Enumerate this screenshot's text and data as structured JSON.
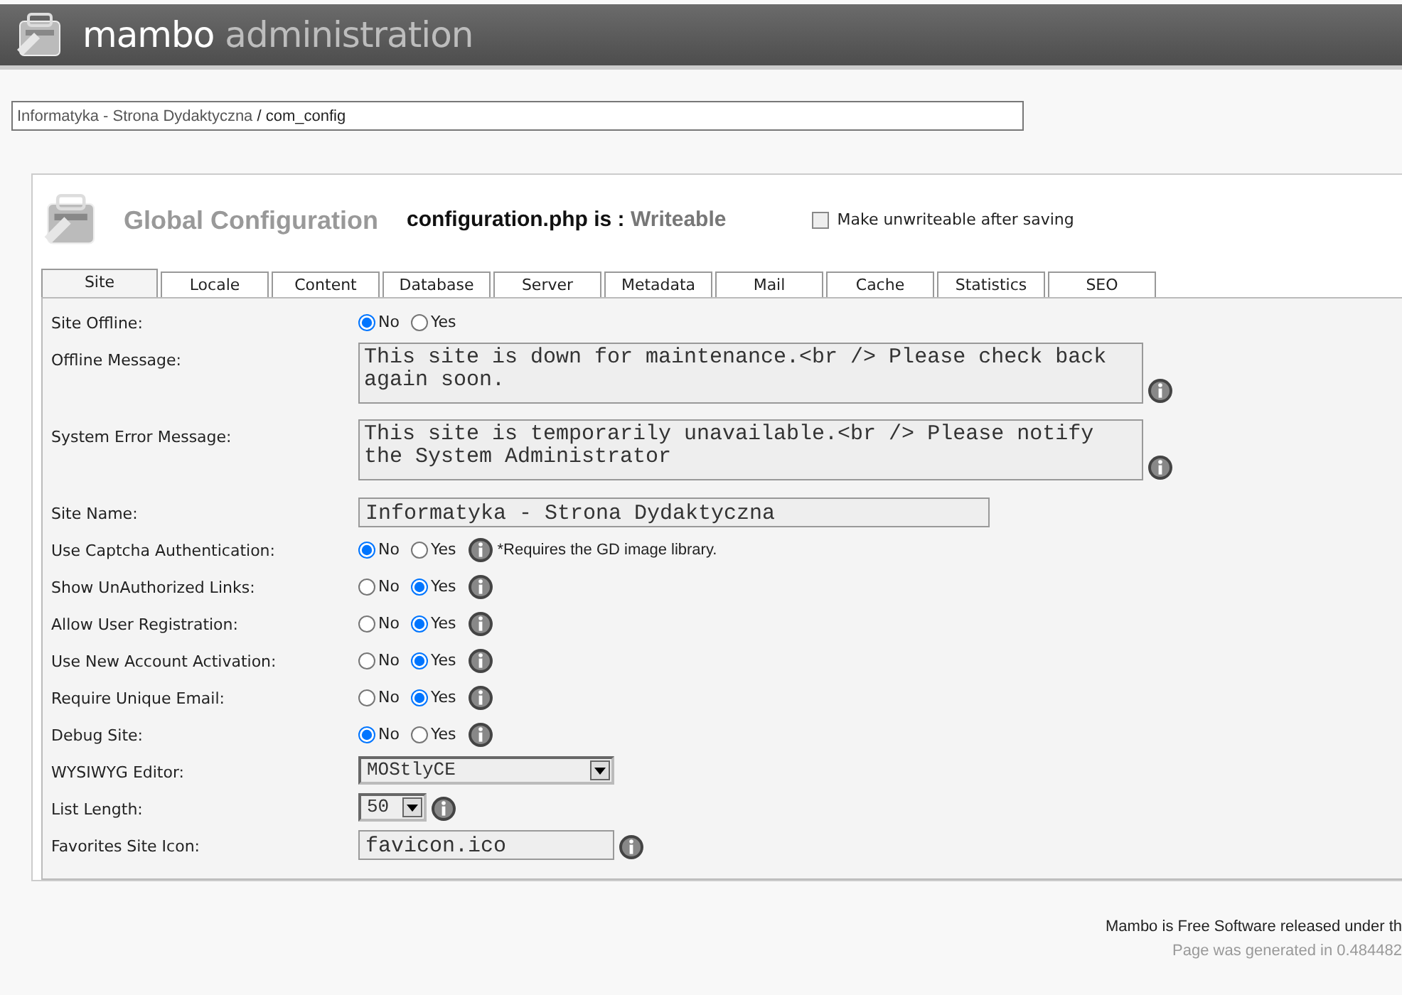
{
  "header": {
    "brand_bold": "mambo",
    "brand_light": "administration"
  },
  "pathway": {
    "site": "Informatyka - Strona Dydaktyczna",
    "rest": " / com_config"
  },
  "config": {
    "title": "Global Configuration",
    "file_label": "configuration.php is :",
    "file_status": "Writeable",
    "unwriteable": {
      "label": "Make unwriteable after saving",
      "checked": false
    }
  },
  "tabs": [
    {
      "label": "Site",
      "selected": true
    },
    {
      "label": "Locale",
      "selected": false
    },
    {
      "label": "Content",
      "selected": false
    },
    {
      "label": "Database",
      "selected": false
    },
    {
      "label": "Server",
      "selected": false
    },
    {
      "label": "Metadata",
      "selected": false
    },
    {
      "label": "Mail",
      "selected": false
    },
    {
      "label": "Cache",
      "selected": false
    },
    {
      "label": "Statistics",
      "selected": false
    },
    {
      "label": "SEO",
      "selected": false
    }
  ],
  "rows": [
    {
      "label": "Site Offline:",
      "kind": "radio",
      "info": false,
      "options": [
        {
          "label": "No",
          "selected": true
        },
        {
          "label": "Yes",
          "selected": false
        }
      ]
    },
    {
      "label": "Offline Message:",
      "kind": "textarea",
      "info": true,
      "value": "This site is down for maintenance.<br /> Please check back again soon."
    },
    {
      "label": "System Error Message:",
      "kind": "textarea",
      "info": true,
      "value": "This site is temporarily unavailable.<br /> Please notify the System Administrator"
    },
    {
      "label": "Site Name:",
      "kind": "text",
      "info": false,
      "value": "Informatyka - Strona Dydaktyczna"
    },
    {
      "label": "Use Captcha Authentication:",
      "kind": "radio",
      "info": true,
      "note": "*Requires the GD image library.",
      "options": [
        {
          "label": "No",
          "selected": true
        },
        {
          "label": "Yes",
          "selected": false
        }
      ]
    },
    {
      "label": "Show UnAuthorized Links:",
      "kind": "radio",
      "info": true,
      "options": [
        {
          "label": "No",
          "selected": false
        },
        {
          "label": "Yes",
          "selected": true
        }
      ]
    },
    {
      "label": "Allow User Registration:",
      "kind": "radio",
      "info": true,
      "options": [
        {
          "label": "No",
          "selected": false
        },
        {
          "label": "Yes",
          "selected": true
        }
      ]
    },
    {
      "label": "Use New Account Activation:",
      "kind": "radio",
      "info": true,
      "options": [
        {
          "label": "No",
          "selected": false
        },
        {
          "label": "Yes",
          "selected": true
        }
      ]
    },
    {
      "label": "Require Unique Email:",
      "kind": "radio",
      "info": true,
      "options": [
        {
          "label": "No",
          "selected": false
        },
        {
          "label": "Yes",
          "selected": true
        }
      ]
    },
    {
      "label": "Debug Site:",
      "kind": "radio",
      "info": true,
      "options": [
        {
          "label": "No",
          "selected": true
        },
        {
          "label": "Yes",
          "selected": false
        }
      ]
    },
    {
      "label": "WYSIWYG Editor:",
      "kind": "select",
      "info": false,
      "value": "MOStlyCE"
    },
    {
      "label": "List Length:",
      "kind": "select",
      "info": true,
      "value": "50"
    },
    {
      "label": "Favorites Site Icon:",
      "kind": "text",
      "info": true,
      "value": "favicon.ico"
    }
  ],
  "footer": {
    "link": "Mambo",
    "text": " is Free Software released under th",
    "generated": "Page was generated in 0.484482"
  }
}
